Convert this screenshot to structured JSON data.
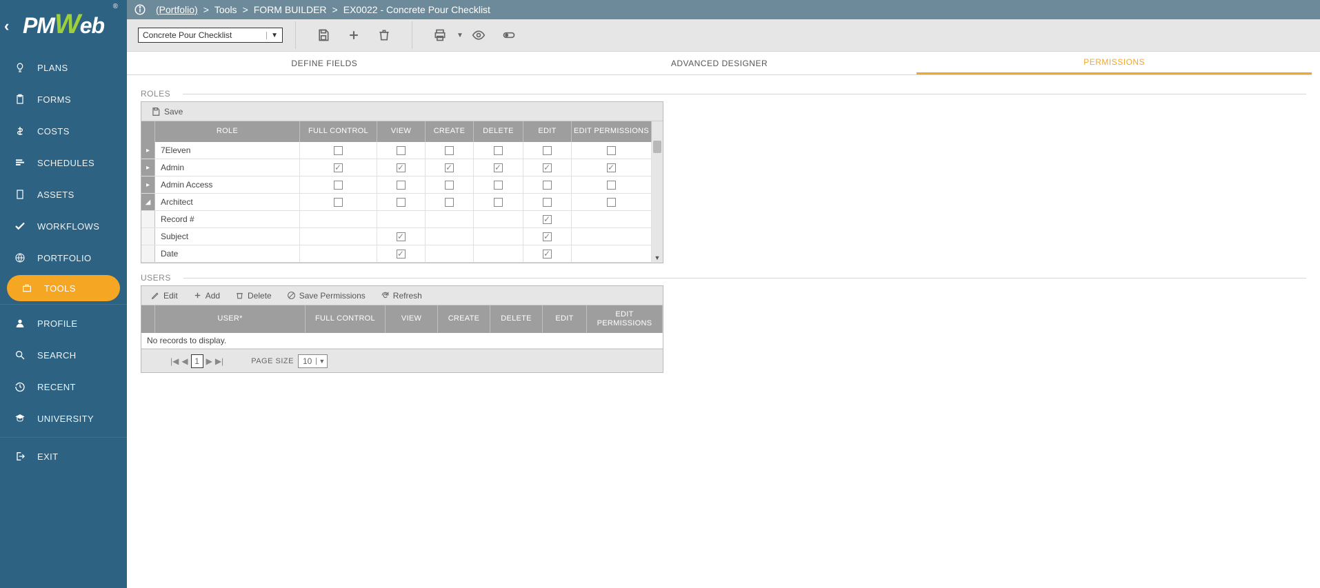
{
  "logo": {
    "pm": "PM",
    "w": "W",
    "eb": "eb",
    "reg": "®"
  },
  "sidebar": {
    "items": [
      {
        "label": "PLANS",
        "icon": "bulb"
      },
      {
        "label": "FORMS",
        "icon": "clipboard"
      },
      {
        "label": "COSTS",
        "icon": "dollar"
      },
      {
        "label": "SCHEDULES",
        "icon": "bars"
      },
      {
        "label": "ASSETS",
        "icon": "building"
      },
      {
        "label": "WORKFLOWS",
        "icon": "check"
      },
      {
        "label": "PORTFOLIO",
        "icon": "globe"
      },
      {
        "label": "TOOLS",
        "icon": "briefcase",
        "active": true
      },
      {
        "label": "PROFILE",
        "icon": "person"
      },
      {
        "label": "SEARCH",
        "icon": "magnify"
      },
      {
        "label": "RECENT",
        "icon": "history"
      },
      {
        "label": "UNIVERSITY",
        "icon": "gradcap"
      },
      {
        "label": "EXIT",
        "icon": "exit"
      }
    ]
  },
  "breadcrumb": {
    "items": [
      "(Portfolio)",
      "Tools",
      "FORM BUILDER",
      "EX0022 - Concrete Pour Checklist"
    ],
    "sep": ">"
  },
  "toolbar": {
    "select_value": "Concrete Pour Checklist"
  },
  "tabs": {
    "items": [
      {
        "label": "DEFINE FIELDS"
      },
      {
        "label": "ADVANCED DESIGNER"
      },
      {
        "label": "PERMISSIONS",
        "active": true
      }
    ]
  },
  "roles_section": {
    "title": "ROLES",
    "save_label": "Save",
    "columns": [
      "ROLE",
      "FULL CONTROL",
      "VIEW",
      "CREATE",
      "DELETE",
      "EDIT",
      "EDIT PERMISSIONS"
    ],
    "rows": [
      {
        "name": "7Eleven",
        "fc": false,
        "view": false,
        "create": false,
        "delete": false,
        "edit": false,
        "ep": false,
        "expanded": false
      },
      {
        "name": "Admin",
        "fc": true,
        "view": true,
        "create": true,
        "delete": true,
        "edit": true,
        "ep": true,
        "expanded": false
      },
      {
        "name": "Admin Access",
        "fc": false,
        "view": false,
        "create": false,
        "delete": false,
        "edit": false,
        "ep": false,
        "expanded": false
      },
      {
        "name": "Architect",
        "fc": false,
        "view": false,
        "create": false,
        "delete": false,
        "edit": false,
        "ep": false,
        "expanded": true,
        "children": [
          {
            "name": "Record #",
            "view": null,
            "edit": true
          },
          {
            "name": "Subject",
            "view": true,
            "edit": true
          },
          {
            "name": "Date",
            "view": true,
            "edit": true
          }
        ]
      }
    ]
  },
  "users_section": {
    "title": "USERS",
    "toolbar": {
      "edit": "Edit",
      "add": "Add",
      "delete": "Delete",
      "save": "Save Permissions",
      "refresh": "Refresh"
    },
    "columns": [
      "USER*",
      "FULL CONTROL",
      "VIEW",
      "CREATE",
      "DELETE",
      "EDIT",
      "EDIT PERMISSIONS"
    ],
    "empty": "No records to display.",
    "pager": {
      "page": "1",
      "page_size_label": "PAGE SIZE",
      "page_size": "10"
    }
  }
}
